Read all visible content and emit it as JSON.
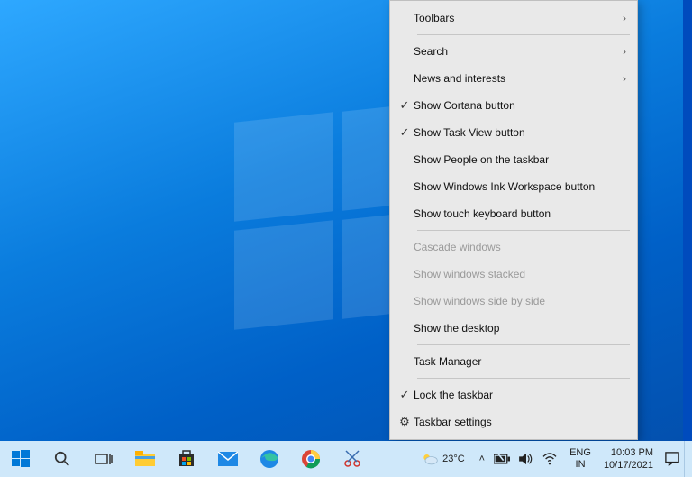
{
  "context_menu": {
    "toolbars": "Toolbars",
    "search": "Search",
    "news": "News and interests",
    "cortana": "Show Cortana button",
    "taskview": "Show Task View button",
    "people": "Show People on the taskbar",
    "ink": "Show Windows Ink Workspace button",
    "touchkb": "Show touch keyboard button",
    "cascade": "Cascade windows",
    "stacked": "Show windows stacked",
    "sidebyside": "Show windows side by side",
    "showdesktop": "Show the desktop",
    "taskmgr": "Task Manager",
    "lock": "Lock the taskbar",
    "settings": "Taskbar settings"
  },
  "taskbar": {
    "weather_temp": "23°C",
    "lang_primary": "ENG",
    "lang_secondary": "IN",
    "time": "10:03 PM",
    "date": "10/17/2021"
  }
}
